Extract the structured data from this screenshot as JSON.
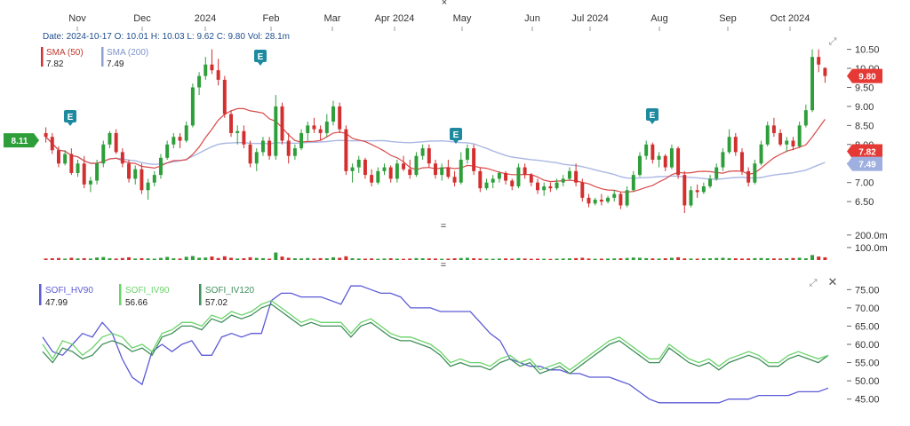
{
  "chart_data": {
    "type": "candlestick",
    "x_months": [
      "Nov",
      "Dec",
      "2024",
      "Feb",
      "Mar",
      "Apr 2024",
      "May",
      "Jun",
      "Jul 2024",
      "Aug",
      "Sep",
      "Oct 2024"
    ],
    "info_line": "Date: 2024-10-17 O: 10.01 H: 10.03 L: 9.62 C: 9.80 Vol: 28.1m",
    "price_axis": {
      "ticks": [
        "10.50",
        "10.00",
        "9.50",
        "9.00",
        "8.50",
        "8.00",
        "7.50",
        "7.00",
        "6.50"
      ],
      "ylim": [
        6.2,
        10.7
      ]
    },
    "last_price_label": "9.80",
    "left_price_label": "8.11",
    "ohlc": [
      [
        8.3,
        8.45,
        8.05,
        8.2
      ],
      [
        8.2,
        8.3,
        7.75,
        7.85
      ],
      [
        7.85,
        7.95,
        7.4,
        7.5
      ],
      [
        7.5,
        7.85,
        7.45,
        7.75
      ],
      [
        7.75,
        7.9,
        7.2,
        7.25
      ],
      [
        7.25,
        7.6,
        7.15,
        7.5
      ],
      [
        7.5,
        7.7,
        6.85,
        6.95
      ],
      [
        6.95,
        7.15,
        6.75,
        7.05
      ],
      [
        7.05,
        7.6,
        6.95,
        7.5
      ],
      [
        7.5,
        8.1,
        7.4,
        8.0
      ],
      [
        8.0,
        8.35,
        7.9,
        8.3
      ],
      [
        8.3,
        8.4,
        7.75,
        7.8
      ],
      [
        7.8,
        7.9,
        7.4,
        7.5
      ],
      [
        7.5,
        7.6,
        7.0,
        7.1
      ],
      [
        7.1,
        7.45,
        6.95,
        7.35
      ],
      [
        7.35,
        7.5,
        6.7,
        6.8
      ],
      [
        6.8,
        7.1,
        6.55,
        7.0
      ],
      [
        7.0,
        7.3,
        6.9,
        7.2
      ],
      [
        7.2,
        7.75,
        7.1,
        7.65
      ],
      [
        7.65,
        8.1,
        7.6,
        8.0
      ],
      [
        8.0,
        8.3,
        7.9,
        8.2
      ],
      [
        8.2,
        8.3,
        7.9,
        8.1
      ],
      [
        8.1,
        8.6,
        8.05,
        8.5
      ],
      [
        8.5,
        9.6,
        8.45,
        9.5
      ],
      [
        9.5,
        9.9,
        9.3,
        9.8
      ],
      [
        9.8,
        10.3,
        9.7,
        10.1
      ],
      [
        10.1,
        10.5,
        9.85,
        9.95
      ],
      [
        9.95,
        10.25,
        9.55,
        9.7
      ],
      [
        9.7,
        9.8,
        8.7,
        8.8
      ],
      [
        8.8,
        8.9,
        8.2,
        8.3
      ],
      [
        8.3,
        8.5,
        8.0,
        8.35
      ],
      [
        8.35,
        8.5,
        7.9,
        8.0
      ],
      [
        8.0,
        8.1,
        7.4,
        7.5
      ],
      [
        7.5,
        7.9,
        7.3,
        7.8
      ],
      [
        7.8,
        8.2,
        7.7,
        8.1
      ],
      [
        8.1,
        8.2,
        7.6,
        7.7
      ],
      [
        7.7,
        9.3,
        7.6,
        9.0
      ],
      [
        9.0,
        9.1,
        8.0,
        8.1
      ],
      [
        8.1,
        8.3,
        7.5,
        7.7
      ],
      [
        7.7,
        8.0,
        7.6,
        7.9
      ],
      [
        7.9,
        8.4,
        7.85,
        8.3
      ],
      [
        8.3,
        8.6,
        8.1,
        8.5
      ],
      [
        8.5,
        8.7,
        8.3,
        8.4
      ],
      [
        8.4,
        8.5,
        8.1,
        8.3
      ],
      [
        8.3,
        8.8,
        8.2,
        8.6
      ],
      [
        8.6,
        9.15,
        8.5,
        9.0
      ],
      [
        9.0,
        9.1,
        8.3,
        8.4
      ],
      [
        8.4,
        8.5,
        7.2,
        7.3
      ],
      [
        7.3,
        7.5,
        7.0,
        7.4
      ],
      [
        7.4,
        7.7,
        7.25,
        7.6
      ],
      [
        7.6,
        7.65,
        7.1,
        7.2
      ],
      [
        7.2,
        7.35,
        6.9,
        7.0
      ],
      [
        7.0,
        7.4,
        6.95,
        7.3
      ],
      [
        7.3,
        7.5,
        7.2,
        7.4
      ],
      [
        7.4,
        7.45,
        7.0,
        7.1
      ],
      [
        7.1,
        7.6,
        7.0,
        7.5
      ],
      [
        7.5,
        7.7,
        7.3,
        7.35
      ],
      [
        7.35,
        7.6,
        7.1,
        7.2
      ],
      [
        7.2,
        7.8,
        7.15,
        7.7
      ],
      [
        7.7,
        8.0,
        7.6,
        7.9
      ],
      [
        7.9,
        8.0,
        7.4,
        7.5
      ],
      [
        7.5,
        7.6,
        7.1,
        7.2
      ],
      [
        7.2,
        7.5,
        7.05,
        7.4
      ],
      [
        7.4,
        7.6,
        7.1,
        7.15
      ],
      [
        7.15,
        7.3,
        6.9,
        7.0
      ],
      [
        7.0,
        7.8,
        6.95,
        7.6
      ],
      [
        7.6,
        8.0,
        7.5,
        7.9
      ],
      [
        7.9,
        8.0,
        7.2,
        7.3
      ],
      [
        7.3,
        7.4,
        6.75,
        6.85
      ],
      [
        6.85,
        7.1,
        6.8,
        7.0
      ],
      [
        7.0,
        7.2,
        6.85,
        7.1
      ],
      [
        7.1,
        7.3,
        7.0,
        7.25
      ],
      [
        7.25,
        7.3,
        6.95,
        7.05
      ],
      [
        7.05,
        7.1,
        6.8,
        6.9
      ],
      [
        6.9,
        7.5,
        6.85,
        7.4
      ],
      [
        7.4,
        7.5,
        7.1,
        7.2
      ],
      [
        7.2,
        7.25,
        6.9,
        7.0
      ],
      [
        7.0,
        7.1,
        6.7,
        6.8
      ],
      [
        6.8,
        7.0,
        6.65,
        6.9
      ],
      [
        6.9,
        7.0,
        6.75,
        6.85
      ],
      [
        6.85,
        7.1,
        6.8,
        7.0
      ],
      [
        7.0,
        7.2,
        6.9,
        7.1
      ],
      [
        7.1,
        7.4,
        7.05,
        7.3
      ],
      [
        7.3,
        7.5,
        6.9,
        7.0
      ],
      [
        7.0,
        7.1,
        6.5,
        6.6
      ],
      [
        6.6,
        6.7,
        6.35,
        6.45
      ],
      [
        6.45,
        6.6,
        6.4,
        6.55
      ],
      [
        6.55,
        6.7,
        6.4,
        6.5
      ],
      [
        6.5,
        6.65,
        6.45,
        6.6
      ],
      [
        6.6,
        6.8,
        6.5,
        6.7
      ],
      [
        6.7,
        6.75,
        6.3,
        6.4
      ],
      [
        6.4,
        6.9,
        6.35,
        6.8
      ],
      [
        6.8,
        7.3,
        6.75,
        7.2
      ],
      [
        7.2,
        7.8,
        7.15,
        7.7
      ],
      [
        7.7,
        8.1,
        7.6,
        8.0
      ],
      [
        8.0,
        8.05,
        7.5,
        7.6
      ],
      [
        7.6,
        7.8,
        7.4,
        7.7
      ],
      [
        7.7,
        7.75,
        7.3,
        7.4
      ],
      [
        7.4,
        8.0,
        7.35,
        7.9
      ],
      [
        7.9,
        7.95,
        7.1,
        7.2
      ],
      [
        7.2,
        7.3,
        6.2,
        6.4
      ],
      [
        6.4,
        6.9,
        6.35,
        6.8
      ],
      [
        6.8,
        6.95,
        6.6,
        6.75
      ],
      [
        6.75,
        7.0,
        6.7,
        6.9
      ],
      [
        6.9,
        7.2,
        6.85,
        7.1
      ],
      [
        7.1,
        7.5,
        7.05,
        7.4
      ],
      [
        7.4,
        7.9,
        7.3,
        7.8
      ],
      [
        7.8,
        8.4,
        7.75,
        8.2
      ],
      [
        8.2,
        8.3,
        7.7,
        7.8
      ],
      [
        7.8,
        7.9,
        7.2,
        7.3
      ],
      [
        7.3,
        7.4,
        6.9,
        7.0
      ],
      [
        7.0,
        7.6,
        6.95,
        7.5
      ],
      [
        7.5,
        8.1,
        7.45,
        8.0
      ],
      [
        8.0,
        8.6,
        7.95,
        8.5
      ],
      [
        8.5,
        8.7,
        8.2,
        8.3
      ],
      [
        8.3,
        8.4,
        7.95,
        8.0
      ],
      [
        8.0,
        8.2,
        7.8,
        8.1
      ],
      [
        8.1,
        8.2,
        7.85,
        7.95
      ],
      [
        7.95,
        8.6,
        7.9,
        8.5
      ],
      [
        8.5,
        9.05,
        8.45,
        8.9
      ],
      [
        8.9,
        10.5,
        8.85,
        10.3
      ],
      [
        10.3,
        10.5,
        9.9,
        10.1
      ],
      [
        10.01,
        10.03,
        9.62,
        9.8
      ]
    ],
    "volume": [
      12,
      14,
      16,
      11,
      18,
      13,
      15,
      12,
      20,
      24,
      14,
      12,
      16,
      22,
      12,
      15,
      13,
      11,
      17,
      25,
      14,
      12,
      26,
      32,
      18,
      20,
      28,
      16,
      30,
      18,
      12,
      14,
      22,
      17,
      15,
      11,
      60,
      28,
      18,
      14,
      13,
      16,
      12,
      15,
      14,
      22,
      18,
      30,
      14,
      12,
      11,
      13,
      10,
      12,
      14,
      11,
      10,
      12,
      15,
      14,
      13,
      12,
      10,
      11,
      14,
      16,
      18,
      14,
      12,
      11,
      10,
      12,
      13,
      11,
      15,
      12,
      10,
      11,
      10,
      9,
      11,
      12,
      13,
      15,
      18,
      12,
      10,
      11,
      12,
      13,
      14,
      16,
      20,
      18,
      15,
      13,
      12,
      14,
      18,
      22,
      13,
      12,
      11,
      13,
      14,
      16,
      18,
      15,
      14,
      12,
      13,
      15,
      16,
      14,
      13,
      12,
      14,
      16,
      18,
      14,
      40,
      28,
      22
    ],
    "volume_axis": {
      "ticks": [
        "200.0m",
        "100.0m"
      ]
    },
    "legend": [
      {
        "name": "SMA (50)",
        "value": "7.82",
        "color": "#d32f2f"
      },
      {
        "name": "SMA (200)",
        "value": "7.49",
        "color": "#8e9fd6"
      }
    ],
    "sma_labels": {
      "sma50": "7.82",
      "sma200": "7.49"
    },
    "earnings_markers": [
      {
        "label": "E",
        "month_index": 0.1
      },
      {
        "label": "E",
        "month_index": 2.8
      },
      {
        "label": "E",
        "month_index": 5.6
      },
      {
        "label": "E",
        "month_index": 8.7
      }
    ],
    "iv_panel": {
      "ticks": [
        "75.00",
        "70.00",
        "65.00",
        "60.00",
        "55.00",
        "50.00",
        "45.00"
      ],
      "ylim": [
        42,
        78
      ],
      "series": [
        {
          "name": "SOFI_HV90",
          "value": "47.99",
          "color": "#5b5bd6"
        },
        {
          "name": "SOFI_IV90",
          "value": "56.66",
          "color": "#6ad36a"
        },
        {
          "name": "SOFI_IV120",
          "value": "57.02",
          "color": "#3f8f5a"
        }
      ]
    }
  }
}
